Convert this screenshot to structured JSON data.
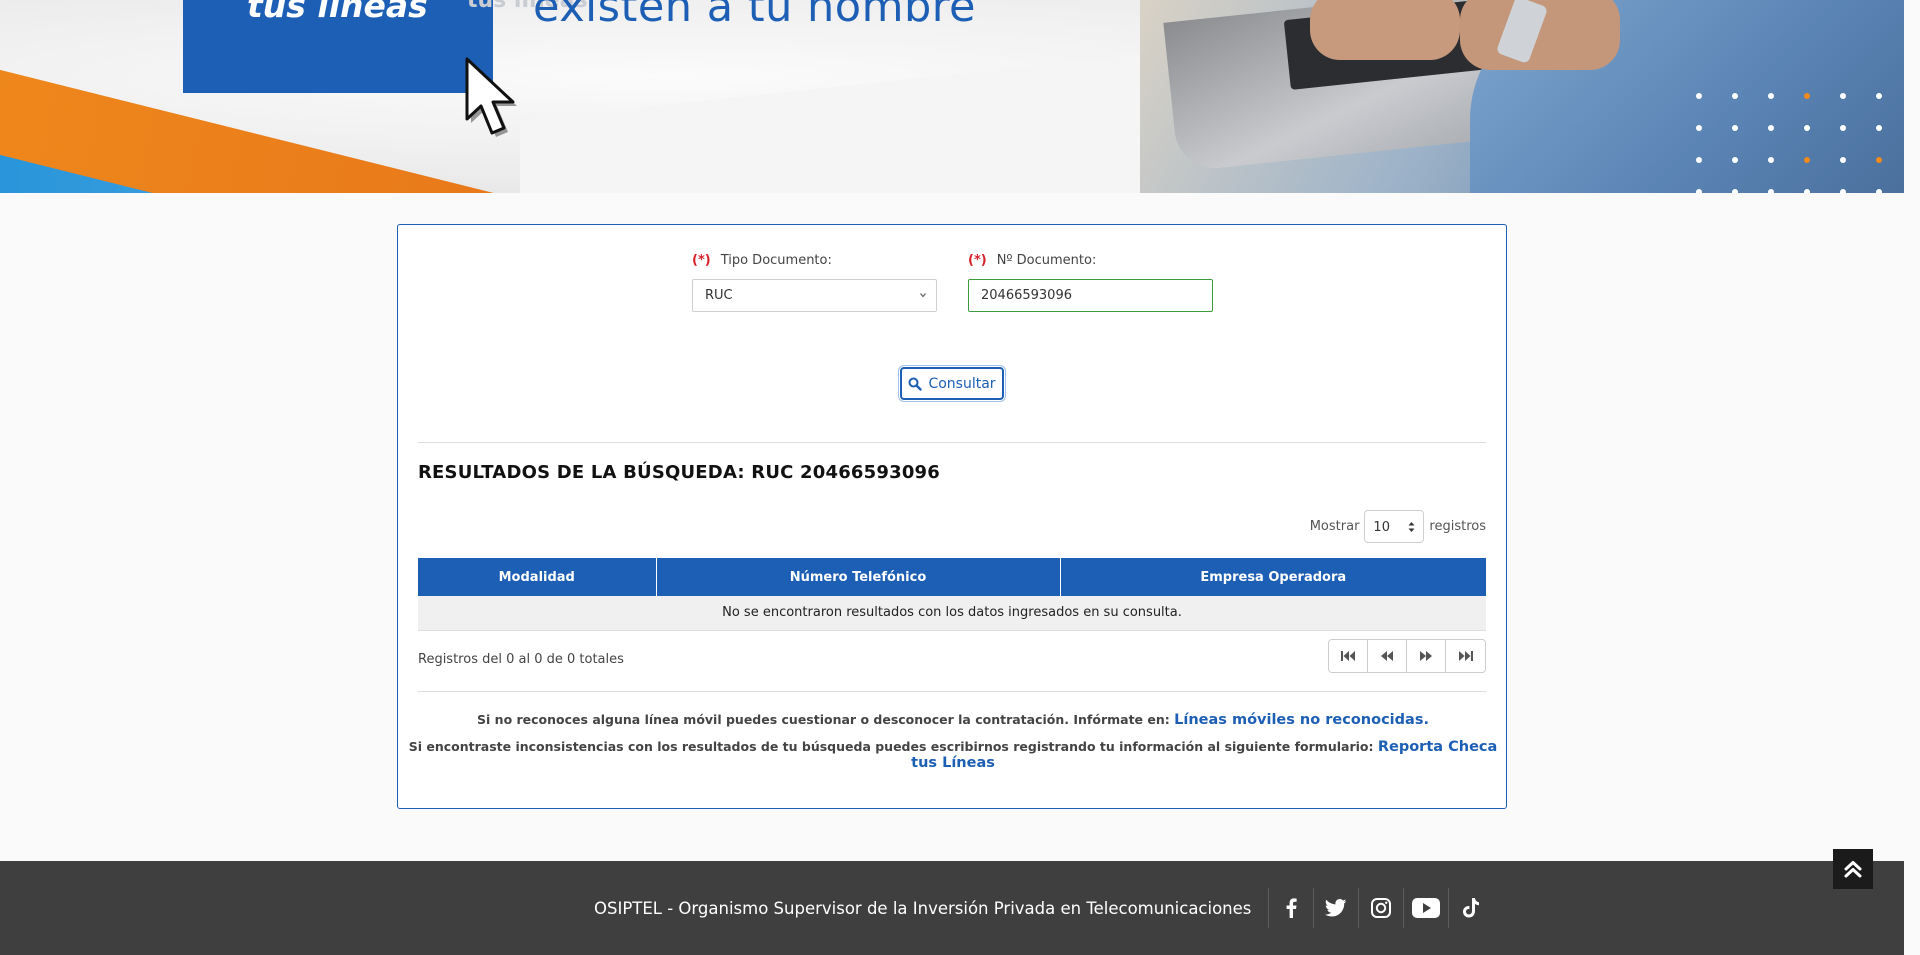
{
  "banner": {
    "box_text": "tus líneas",
    "ghost_text": "tus líneas",
    "title": "existen a tu nombre"
  },
  "form": {
    "tipo_label": "Tipo Documento:",
    "nro_label": "Nº Documento:",
    "required_mark": "(*)",
    "tipo_value": "RUC",
    "nro_value": "20466593096",
    "consultar_label": "Consultar"
  },
  "results": {
    "title": "RESULTADOS DE LA BÚSQUEDA: RUC 20466593096",
    "show_label": "Mostrar",
    "show_value": "10",
    "records_label": "registros",
    "columns": [
      "Modalidad",
      "Número Telefónico",
      "Empresa Operadora"
    ],
    "empty_message": "No se encontraron resultados con los datos ingresados en su consulta.",
    "info": "Registros del 0 al 0 de 0 totales"
  },
  "notes": {
    "line1_text": "Si no reconoces alguna línea móvil puedes cuestionar o desconocer la contratación. Infórmate en:",
    "line1_link": "Líneas móviles no reconocidas.",
    "line2_text": "Si encontraste inconsistencias con los resultados de tu búsqueda puedes escribirnos registrando tu información al siguiente formulario:",
    "line2_link": "Reporta Checa tus Líneas"
  },
  "footer": {
    "text": "OSIPTEL - Organismo Supervisor de la Inversión Privada en Telecomunicaciones",
    "social": [
      "facebook-icon",
      "twitter-icon",
      "instagram-icon",
      "youtube-icon",
      "tiktok-icon"
    ]
  },
  "colors": {
    "brand_blue": "#1d5fb4",
    "accent_orange": "#f08a1c",
    "footer_bg": "#3f3f3f",
    "required_red": "#d6202a"
  }
}
